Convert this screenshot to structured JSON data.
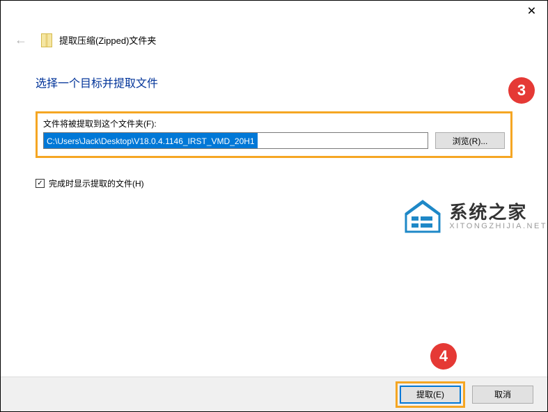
{
  "titlebar": {
    "close_symbol": "✕"
  },
  "header": {
    "back_symbol": "←",
    "title": "提取压缩(Zipped)文件夹"
  },
  "content": {
    "instruction": "选择一个目标并提取文件",
    "field_label": "文件将被提取到这个文件夹(F):",
    "path_value": "C:\\Users\\Jack\\Desktop\\V18.0.4.1146_IRST_VMD_20H1",
    "browse_label": "浏览(R)...",
    "checkbox_checked": "✓",
    "checkbox_label": "完成时显示提取的文件(H)"
  },
  "callouts": {
    "three": "3",
    "four": "4"
  },
  "watermark": {
    "main": "系统之家",
    "sub": "XITONGZHIJIA.NET"
  },
  "footer": {
    "extract_label": "提取(E)",
    "cancel_label": "取消"
  }
}
